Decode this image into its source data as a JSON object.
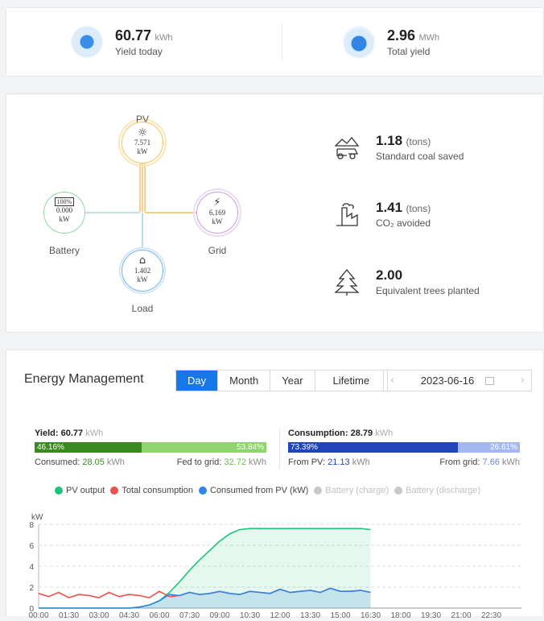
{
  "summary": {
    "yield_today": {
      "value": "60.77",
      "unit": "kWh",
      "label": "Yield today"
    },
    "total_yield": {
      "value": "2.96",
      "unit": "MWh",
      "label": "Total yield"
    }
  },
  "flow": {
    "pv": {
      "label": "PV",
      "value": "7.571",
      "unit": "kW"
    },
    "battery": {
      "label": "Battery",
      "value": "0.000",
      "unit": "kW",
      "soc": "100%"
    },
    "grid": {
      "label": "Grid",
      "value": "6.169",
      "unit": "kW"
    },
    "load": {
      "label": "Load",
      "value": "1.402",
      "unit": "kW"
    }
  },
  "environment": [
    {
      "value": "1.18",
      "unit": "(tons)",
      "label": "Standard coal saved",
      "icon": "coal-truck-icon"
    },
    {
      "value": "1.41",
      "unit": "(tons)",
      "label": "CO₂ avoided",
      "icon": "factory-icon"
    },
    {
      "value": "2.00",
      "unit": "",
      "label": "Equivalent trees planted",
      "icon": "tree-icon"
    }
  ],
  "energy": {
    "title": "Energy Management",
    "tabs": [
      "Day",
      "Month",
      "Year",
      "Lifetime"
    ],
    "active_tab": "Day",
    "date": "2023-06-16",
    "yield": {
      "label": "Yield:",
      "value": "60.77",
      "unit": "kWh",
      "pct_consumed": "46.16%",
      "pct_fed": "53.84%",
      "consumed_label": "Consumed:",
      "consumed_value": "28.05",
      "fed_label": "Fed to grid:",
      "fed_value": "32.72",
      "unit2": "kWh"
    },
    "consumption": {
      "label": "Consumption:",
      "value": "28.79",
      "unit": "kWh",
      "pct_pv": "73.39%",
      "pct_grid": "26.61%",
      "pv_label": "From PV:",
      "pv_value": "21.13",
      "grid_label": "From grid:",
      "grid_value": "7.66",
      "unit2": "kWh"
    },
    "legend": [
      {
        "name": "PV output",
        "color": "#1fc37a",
        "active": true
      },
      {
        "name": "Total consumption",
        "color": "#f0504a",
        "active": true
      },
      {
        "name": "Consumed from PV (kW)",
        "color": "#2f86e6",
        "active": true
      },
      {
        "name": "Battery (charge)",
        "color": "#c8c8c8",
        "active": false
      },
      {
        "name": "Battery (discharge)",
        "color": "#c8c8c8",
        "active": false
      }
    ]
  },
  "chart_data": {
    "type": "area",
    "ylabel": "kW",
    "ylim": [
      0,
      8
    ],
    "yticks": [
      0,
      2,
      4,
      6,
      8
    ],
    "xticks": [
      "00:00",
      "01:30",
      "03:00",
      "04:30",
      "06:00",
      "07:30",
      "09:00",
      "10:30",
      "12:00",
      "13:30",
      "15:00",
      "16:30",
      "18:00",
      "19:30",
      "21:00",
      "22:30"
    ],
    "x_hours": [
      0,
      0.5,
      1,
      1.5,
      2,
      2.5,
      3,
      3.5,
      4,
      4.5,
      5,
      5.5,
      6,
      6.5,
      7,
      7.5,
      8,
      8.5,
      9,
      9.5,
      10,
      10.5,
      11,
      11.5,
      12,
      12.5,
      13,
      13.5,
      14,
      14.5,
      15,
      15.5,
      16,
      16.5,
      17
    ],
    "series": [
      {
        "name": "PV output",
        "color": "#1fc37a",
        "values": [
          0,
          0,
          0,
          0,
          0,
          0,
          0,
          0,
          0,
          0,
          0.1,
          0.3,
          0.7,
          1.5,
          2.5,
          3.6,
          4.6,
          5.5,
          6.4,
          7.1,
          7.5,
          7.6,
          7.6,
          7.6,
          7.6,
          7.6,
          7.6,
          7.6,
          7.6,
          7.6,
          7.6,
          7.6,
          7.6,
          7.5,
          null
        ]
      },
      {
        "name": "Total consumption",
        "color": "#f0504a",
        "values": [
          1.4,
          1.1,
          1.5,
          1.0,
          1.3,
          1.2,
          1.0,
          1.5,
          1.1,
          1.3,
          1.2,
          1.0,
          1.6,
          1.1,
          1.2,
          1.5,
          1.3,
          1.4,
          1.6,
          1.4,
          1.3,
          1.6,
          1.5,
          1.4,
          1.8,
          1.5,
          1.6,
          1.7,
          1.5,
          1.9,
          1.6,
          1.6,
          1.7,
          1.5,
          null
        ]
      },
      {
        "name": "Consumed from PV (kW)",
        "color": "#2f86e6",
        "values": [
          0,
          0,
          0,
          0,
          0,
          0,
          0,
          0,
          0,
          0,
          0.1,
          0.3,
          0.7,
          1.3,
          1.2,
          1.5,
          1.3,
          1.4,
          1.6,
          1.4,
          1.3,
          1.6,
          1.5,
          1.4,
          1.8,
          1.5,
          1.6,
          1.7,
          1.5,
          1.9,
          1.6,
          1.6,
          1.7,
          1.5,
          null
        ]
      }
    ]
  }
}
